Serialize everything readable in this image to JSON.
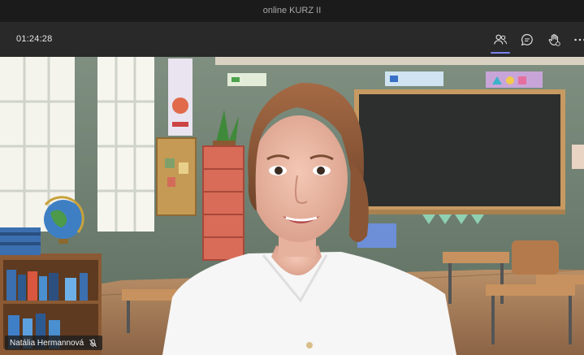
{
  "window": {
    "title": "online KURZ II"
  },
  "meeting": {
    "timer": "01:24:28",
    "toolbar": [
      {
        "name": "participants-button",
        "icon": "people-icon",
        "active": true
      },
      {
        "name": "chat-button",
        "icon": "chat-icon",
        "active": false
      },
      {
        "name": "reactions-button",
        "icon": "raise-hand-icon",
        "active": false
      },
      {
        "name": "more-options-button",
        "icon": "ellipsis-icon",
        "active": false
      }
    ]
  },
  "video": {
    "participant_name": "Natália Hermannová",
    "status_icon": "mic-muted-icon"
  },
  "colors": {
    "accent": "#7b83eb",
    "toolbar_bg": "#292929",
    "titlebar_bg": "#1b1b1b"
  }
}
